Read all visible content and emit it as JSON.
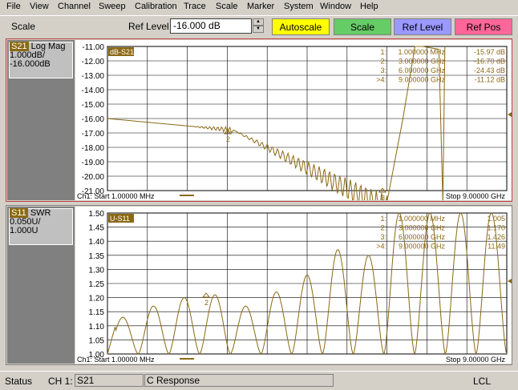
{
  "menu": [
    "File",
    "View",
    "Channel",
    "Sweep",
    "Calibration",
    "Trace",
    "Scale",
    "Marker",
    "System",
    "Window",
    "Help"
  ],
  "toolbar": {
    "title": "Scale",
    "ref_label": "Ref Level",
    "ref_value": "-16.000 dB",
    "buttons": [
      {
        "label": "Autoscale",
        "color": "#ffff00"
      },
      {
        "label": "Scale",
        "color": "#66cc66"
      },
      {
        "label": "Ref Level",
        "color": "#9999ff"
      },
      {
        "label": "Ref Pos",
        "color": "#ff6699"
      }
    ]
  },
  "trace1": {
    "name": "S21",
    "format": "Log Mag",
    "scale": "1.000dB/",
    "ref": "-16.000dB",
    "tag": "dB-S21",
    "yticks": [
      "-11.00",
      "-12.00",
      "-13.00",
      "-14.00",
      "-15.00",
      "-16.00",
      "-17.00",
      "-18.00",
      "-19.00",
      "-20.00",
      "-21.00"
    ],
    "start": "Ch1: Start  1.00000 MHz",
    "stop": "Stop  9.00000 GHz",
    "markers": [
      {
        "n": "1:",
        "freq": "1.000000 MHz",
        "val": "-15.97 dB"
      },
      {
        "n": "2:",
        "freq": "3.000000 GHz",
        "val": "-16.70 dB"
      },
      {
        "n": "3:",
        "freq": "6.000000 GHz",
        "val": "-24.43 dB"
      },
      {
        "n": ">4:",
        "freq": "9.000000 GHz",
        "val": "-11.12 dB"
      }
    ],
    "mk_labels": [
      "2",
      "3"
    ]
  },
  "trace2": {
    "name": "S11",
    "format": "SWR",
    "scale": "0.050U/",
    "ref": "1.000U",
    "tag": "U-S11",
    "yticks": [
      "1.50",
      "1.45",
      "1.40",
      "1.35",
      "1.30",
      "1.25",
      "1.20",
      "1.15",
      "1.10",
      "1.05",
      "1.00"
    ],
    "start": "Ch1: Start  1.00000 MHz",
    "stop": "Stop  9.00000 GHz",
    "markers": [
      {
        "n": "1:",
        "freq": "1.000000 MHz",
        "val": "1.005"
      },
      {
        "n": "2:",
        "freq": "3.000000 GHz",
        "val": "1.170"
      },
      {
        "n": "3:",
        "freq": "6.000000 GHz",
        "val": "1.426"
      },
      {
        "n": ">4:",
        "freq": "9.000000 GHz",
        "val": "11.49"
      }
    ],
    "mk_labels": [
      "2"
    ]
  },
  "status": {
    "label": "Status",
    "channel": "CH 1:",
    "trace": "S21",
    "mode": "C  Response",
    "lcl": "LCL"
  },
  "trace_color": "#8b6914"
}
